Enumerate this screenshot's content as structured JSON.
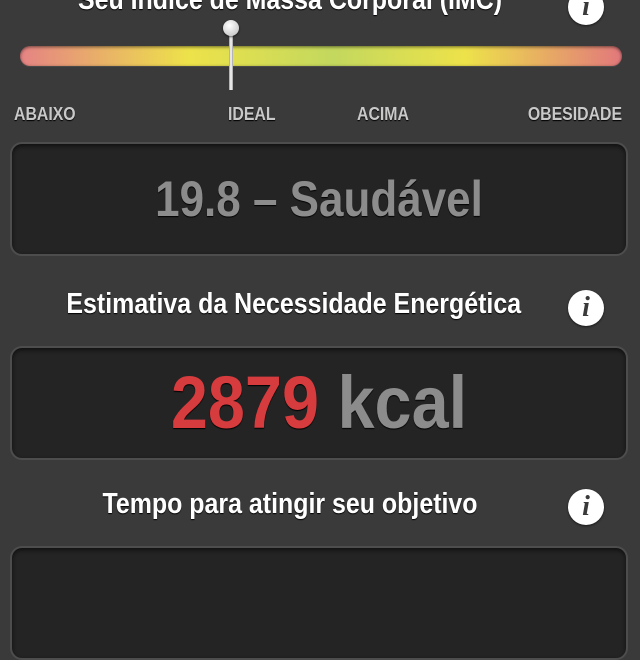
{
  "bmi_section": {
    "title": "Seu Índice de Massa Corporal (IMC)",
    "info_icon": "info-icon",
    "gauge": {
      "level": 0.35,
      "colors": {
        "low": "#e58384",
        "mid": "#ede24a",
        "ideal": "#c3d85e",
        "high": "#e2787c"
      },
      "labels": [
        "ABAIXO",
        "IDEAL",
        "ACIMA",
        "OBESIDADE"
      ]
    },
    "value": "19.8 – Saudável"
  },
  "energy_section": {
    "title": "Estimativa da Necessidade Energética",
    "info_icon": "info-icon",
    "value_number": "2879",
    "value_unit": "kcal",
    "number_color": "#d63b3e"
  },
  "goal_section": {
    "title": "Tempo para atingir seu objetivo",
    "info_icon": "info-icon"
  }
}
